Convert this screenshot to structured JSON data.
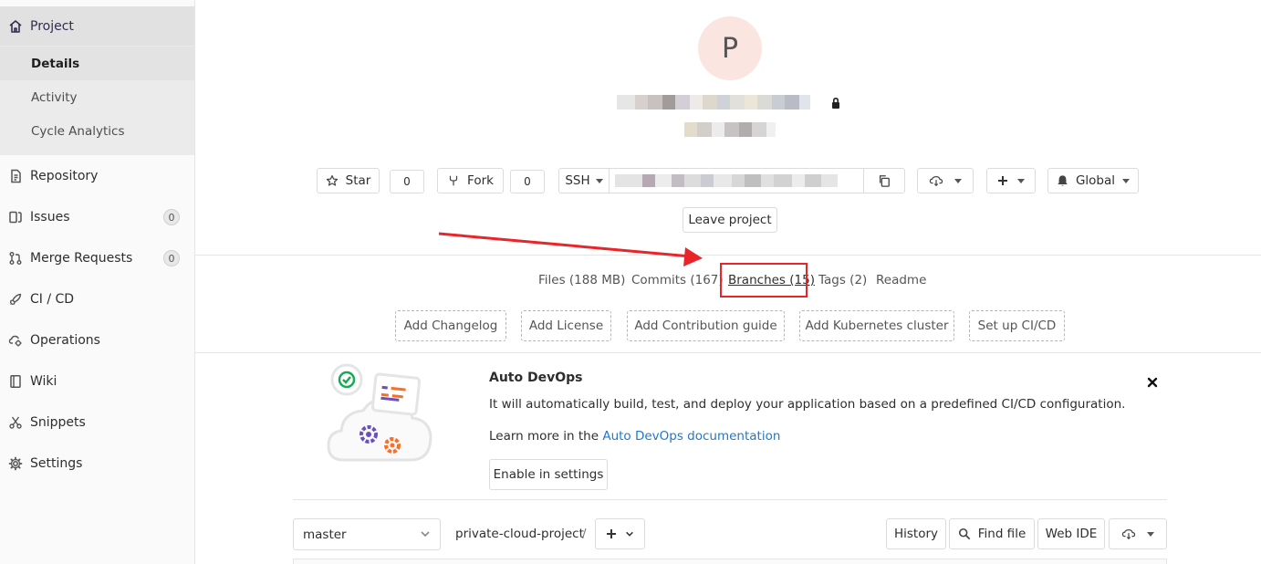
{
  "sidebar": {
    "project": {
      "label": "Project",
      "icon": "home-icon"
    },
    "subitems": [
      {
        "label": "Details",
        "active": true
      },
      {
        "label": "Activity",
        "active": false
      },
      {
        "label": "Cycle Analytics",
        "active": false
      }
    ],
    "items": [
      {
        "label": "Repository",
        "icon": "document-icon"
      },
      {
        "label": "Issues",
        "icon": "issues-icon",
        "badge": "0"
      },
      {
        "label": "Merge Requests",
        "icon": "merge-request-icon",
        "badge": "0"
      },
      {
        "label": "CI / CD",
        "icon": "rocket-icon"
      },
      {
        "label": "Operations",
        "icon": "cloud-gear-icon"
      },
      {
        "label": "Wiki",
        "icon": "book-icon"
      },
      {
        "label": "Snippets",
        "icon": "scissors-icon"
      },
      {
        "label": "Settings",
        "icon": "gear-icon"
      }
    ]
  },
  "project": {
    "avatar_letter": "P"
  },
  "actions": {
    "star_label": "Star",
    "star_count": "0",
    "fork_label": "Fork",
    "fork_count": "0",
    "clone_protocol": "SSH",
    "notifications_label": "Global",
    "leave_label": "Leave project"
  },
  "stats": {
    "files": "Files (188 MB)",
    "commits": "Commits (167)",
    "branches": "Branches (15)",
    "tags": "Tags (2)",
    "readme": "Readme"
  },
  "quick_actions": [
    "Add Changelog",
    "Add License",
    "Add Contribution guide",
    "Add Kubernetes cluster",
    "Set up CI/CD"
  ],
  "auto_devops": {
    "title": "Auto DevOps",
    "description": "It will automatically build, test, and deploy your application based on a predefined CI/CD configuration.",
    "learn_prefix": "Learn more in the ",
    "learn_link": "Auto DevOps documentation",
    "enable_label": "Enable in settings"
  },
  "repo_bar": {
    "branch": "master",
    "path": "private-cloud-project",
    "separator": "/",
    "history_label": "History",
    "find_file_label": "Find file",
    "web_ide_label": "Web IDE"
  },
  "colors": {
    "highlight": "#e8262a",
    "link": "#1f78d1",
    "avatar_bg": "#fbe5e1"
  }
}
